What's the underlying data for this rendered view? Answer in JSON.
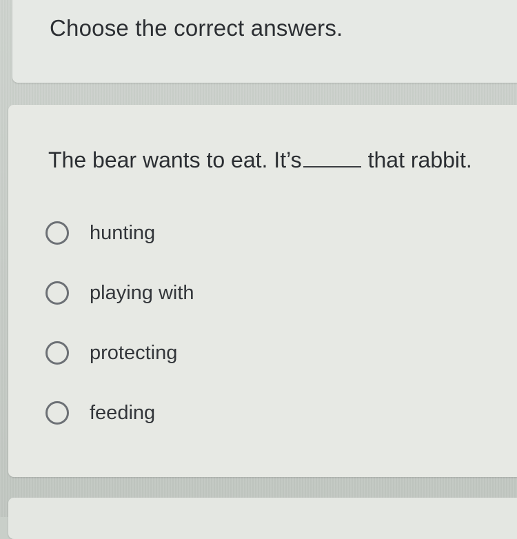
{
  "header": {
    "title": "Choose the correct answers."
  },
  "question": {
    "text_before": "The bear wants to eat. It’s",
    "text_after": "that rabbit.",
    "options": [
      {
        "label": "hunting"
      },
      {
        "label": "playing with"
      },
      {
        "label": "protecting"
      },
      {
        "label": "feeding"
      }
    ]
  }
}
